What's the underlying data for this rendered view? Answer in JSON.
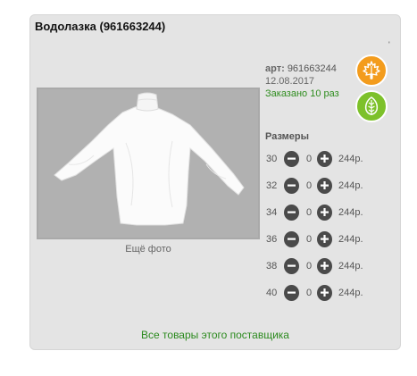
{
  "product": {
    "title": "Водолазка (961663244)",
    "corner_mark": "'",
    "article_label": "арт:",
    "article_value": "961663244",
    "date": "12.08.2017",
    "ordered": "Заказано 10 раз",
    "more_photos": "Ещё фото"
  },
  "badges": [
    {
      "icon": "maple-leaf-icon",
      "color": "#f39c1d"
    },
    {
      "icon": "leaf-icon",
      "color": "#7dc12a"
    }
  ],
  "sizes": {
    "heading": "Размеры",
    "rows": [
      {
        "size": "30",
        "qty": "0",
        "price": "244р."
      },
      {
        "size": "32",
        "qty": "0",
        "price": "244р."
      },
      {
        "size": "34",
        "qty": "0",
        "price": "244р."
      },
      {
        "size": "36",
        "qty": "0",
        "price": "244р."
      },
      {
        "size": "38",
        "qty": "0",
        "price": "244р."
      },
      {
        "size": "40",
        "qty": "0",
        "price": "244р."
      }
    ]
  },
  "footer": {
    "supplier_link": "Все товары этого поставщика"
  }
}
